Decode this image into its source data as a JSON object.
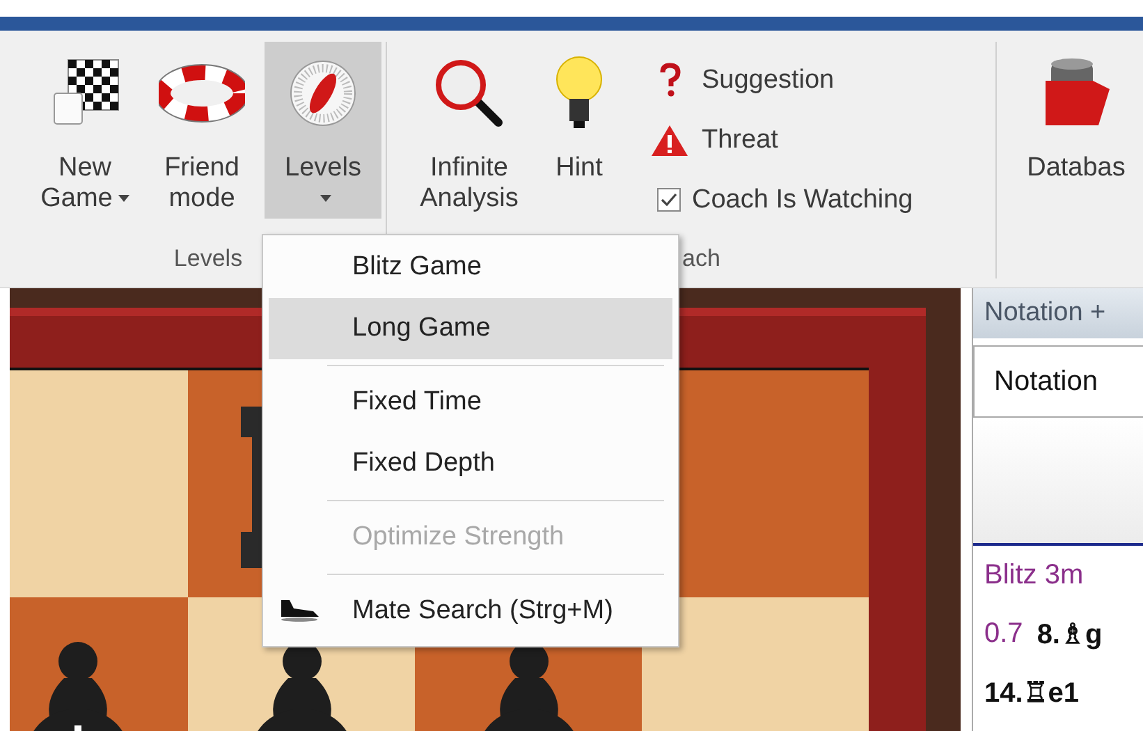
{
  "ribbon": {
    "groups": [
      {
        "label": "Levels",
        "buttons": [
          {
            "kind": "large",
            "label": "New Game",
            "dropdown": true,
            "selected": false
          },
          {
            "kind": "large",
            "label": "Friend mode",
            "dropdown": false,
            "selected": false
          },
          {
            "kind": "large",
            "label": "Levels",
            "dropdown": true,
            "selected": true
          }
        ]
      },
      {
        "label": "ach",
        "buttons": [
          {
            "kind": "large",
            "label": "Infinite Analysis",
            "dropdown": false,
            "selected": false
          },
          {
            "kind": "large",
            "label": "Hint",
            "dropdown": false,
            "selected": false
          },
          {
            "kind": "small",
            "label": "Suggestion"
          },
          {
            "kind": "small",
            "label": "Threat"
          },
          {
            "kind": "checkbox",
            "label": "Coach Is Watching",
            "checked": true
          }
        ]
      },
      {
        "buttons": [
          {
            "kind": "large",
            "label": "Databas",
            "dropdown": false,
            "selected": false
          }
        ]
      }
    ]
  },
  "menu": {
    "items": [
      {
        "kind": "item",
        "label": "Blitz Game",
        "selected": false,
        "disabled": false
      },
      {
        "kind": "item",
        "label": "Long Game",
        "selected": true,
        "disabled": false
      },
      {
        "kind": "separator"
      },
      {
        "kind": "item",
        "label": "Fixed Time",
        "selected": false,
        "disabled": false
      },
      {
        "kind": "item",
        "label": "Fixed Depth",
        "selected": false,
        "disabled": false
      },
      {
        "kind": "separator"
      },
      {
        "kind": "item",
        "label": "Optimize Strength",
        "selected": false,
        "disabled": true
      },
      {
        "kind": "separator"
      },
      {
        "kind": "item",
        "label": "Mate Search (Strg+M)",
        "selected": false,
        "disabled": false
      }
    ]
  },
  "notation": {
    "header": "Notation +",
    "tab": "Notation",
    "lines": [
      [
        {
          "kind": "event",
          "text": "Blitz 3m"
        }
      ],
      [
        {
          "kind": "eval",
          "text": "0.7"
        },
        {
          "kind": "move",
          "text": "8.♗g"
        }
      ],
      [
        {
          "kind": "move",
          "text": "14.♖e1"
        }
      ]
    ]
  }
}
